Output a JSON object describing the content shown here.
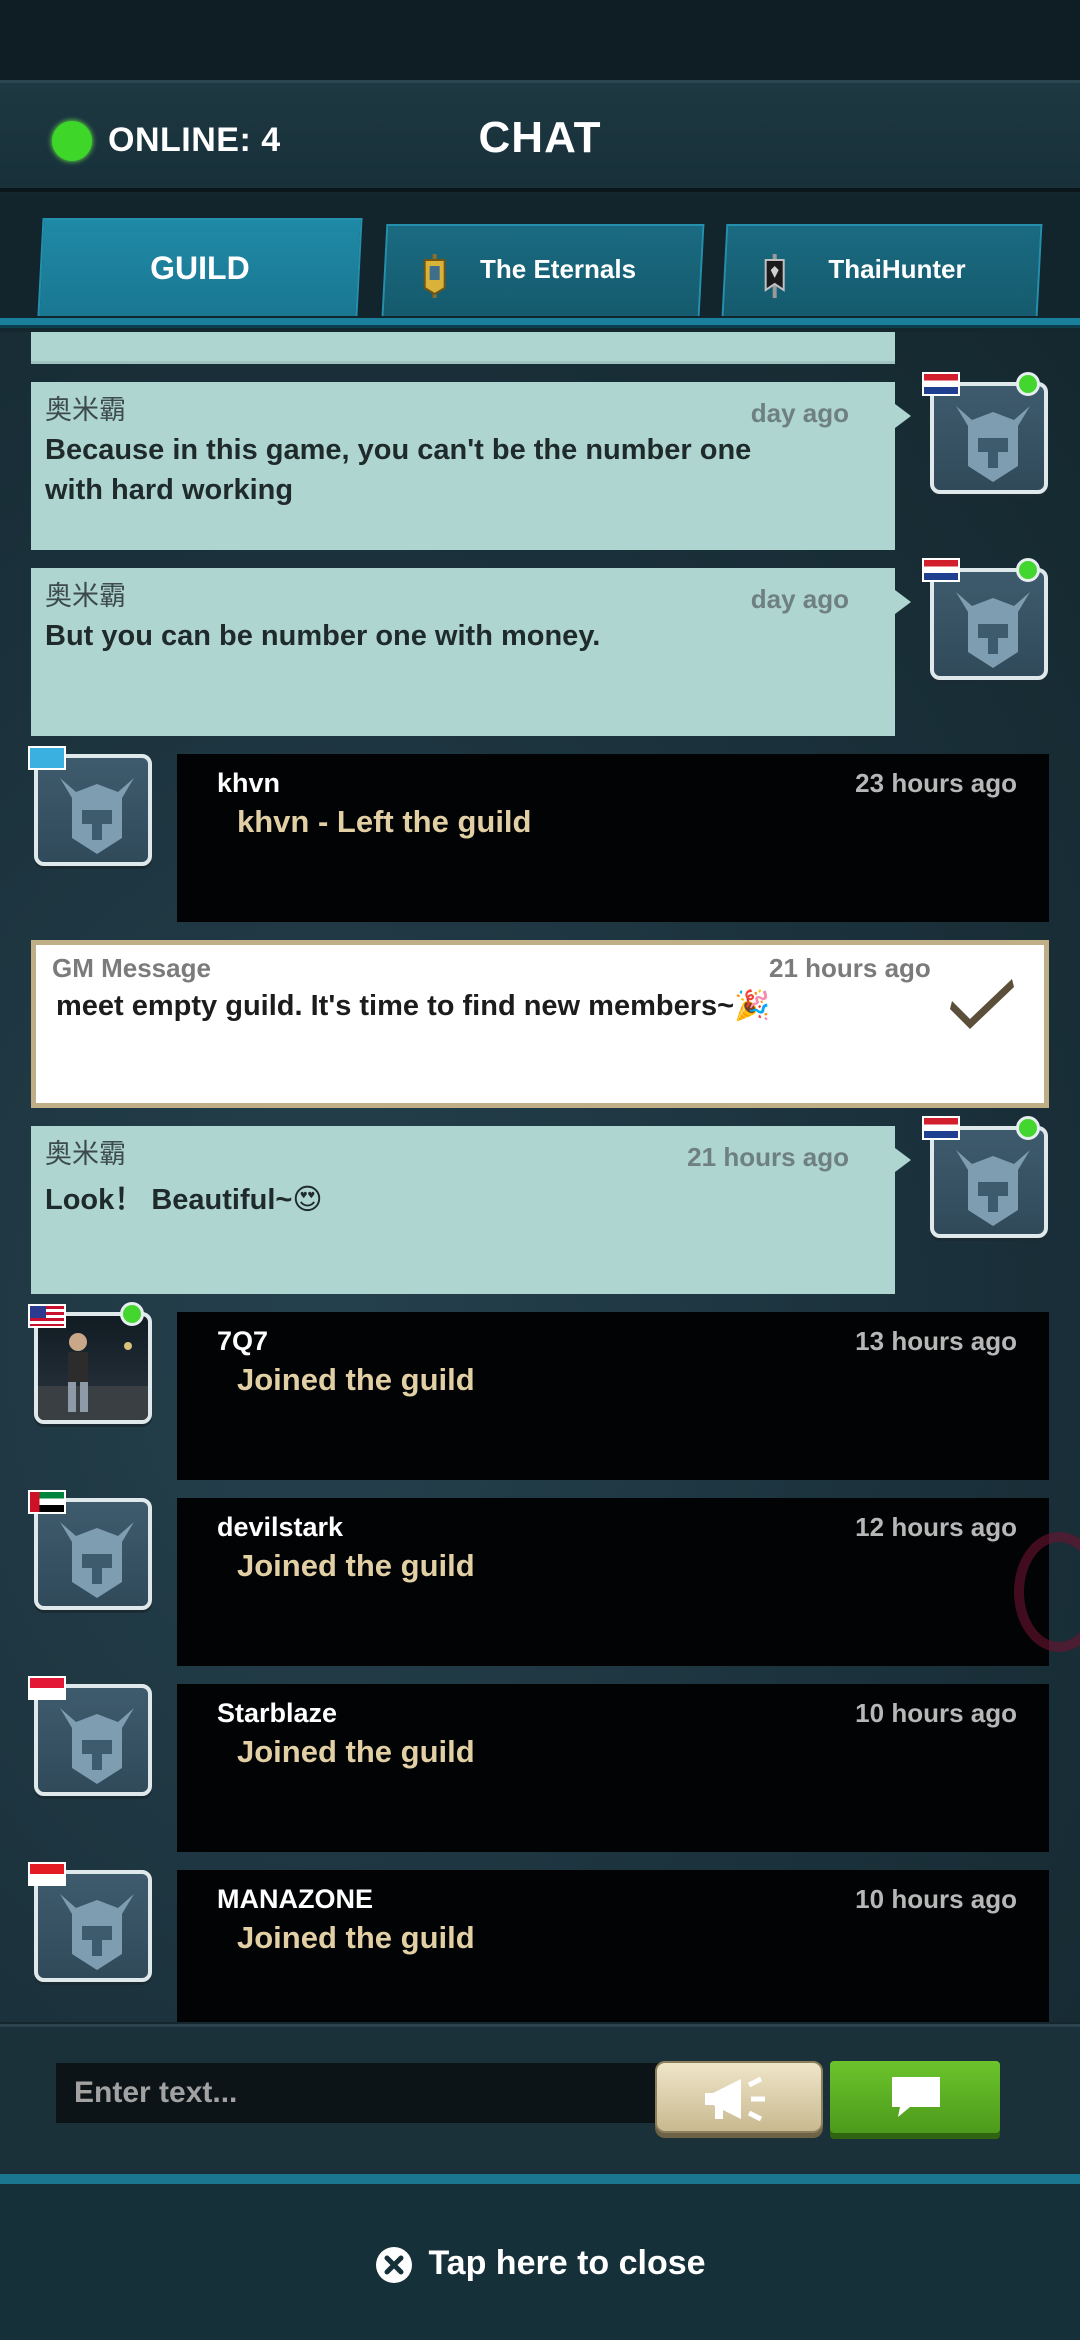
{
  "header": {
    "online_label": "ONLINE: 4",
    "title": "CHAT"
  },
  "tabs": [
    {
      "label": "GUILD",
      "active": true
    },
    {
      "label": "The Eternals",
      "icon": "guild-banner-icon"
    },
    {
      "label": "ThaiHunter",
      "icon": "guild-banner-icon"
    }
  ],
  "messages": [
    {
      "name": "奥米霸",
      "time": "day ago",
      "text": "Because in this game, you can't be the number one with hard working",
      "flag": "netherlands",
      "online": true
    },
    {
      "name": "奥米霸",
      "time": "day ago",
      "text": "But you can be number one with money.",
      "flag": "netherlands",
      "online": true
    },
    {
      "name": "khvn",
      "time": "23 hours ago",
      "text": "khvn - Left the guild",
      "flag": "kazakhstan",
      "online": false
    },
    {
      "name": "GM Message",
      "time": "21 hours ago",
      "text": "meet empty guild.  It's time to find new members~🎉"
    },
    {
      "name": "奥米霸",
      "time": "21 hours ago",
      "text": "Look！ Beautiful~😍",
      "flag": "netherlands",
      "online": true
    },
    {
      "name": "7Q7",
      "time": "13 hours ago",
      "text": "Joined the guild",
      "flag": "usa",
      "online": true
    },
    {
      "name": "devilstark",
      "time": "12 hours ago",
      "text": "Joined the guild",
      "flag": "uae",
      "online": false
    },
    {
      "name": "Starblaze",
      "time": "10 hours ago",
      "text": "Joined the guild",
      "flag": "singapore",
      "online": false
    },
    {
      "name": "MANAZONE",
      "time": "10 hours ago",
      "text": "Joined the guild",
      "flag": "indonesia",
      "online": false
    }
  ],
  "input": {
    "placeholder": "Enter text..."
  },
  "footer": {
    "close_label": "Tap here to close"
  },
  "colors": {
    "online_green": "#3fd62a",
    "tab_blue": "#1a7f9a",
    "own_bubble": "#afd5d0",
    "system_text": "#e2cfa4",
    "send_green": "#5aad22"
  }
}
